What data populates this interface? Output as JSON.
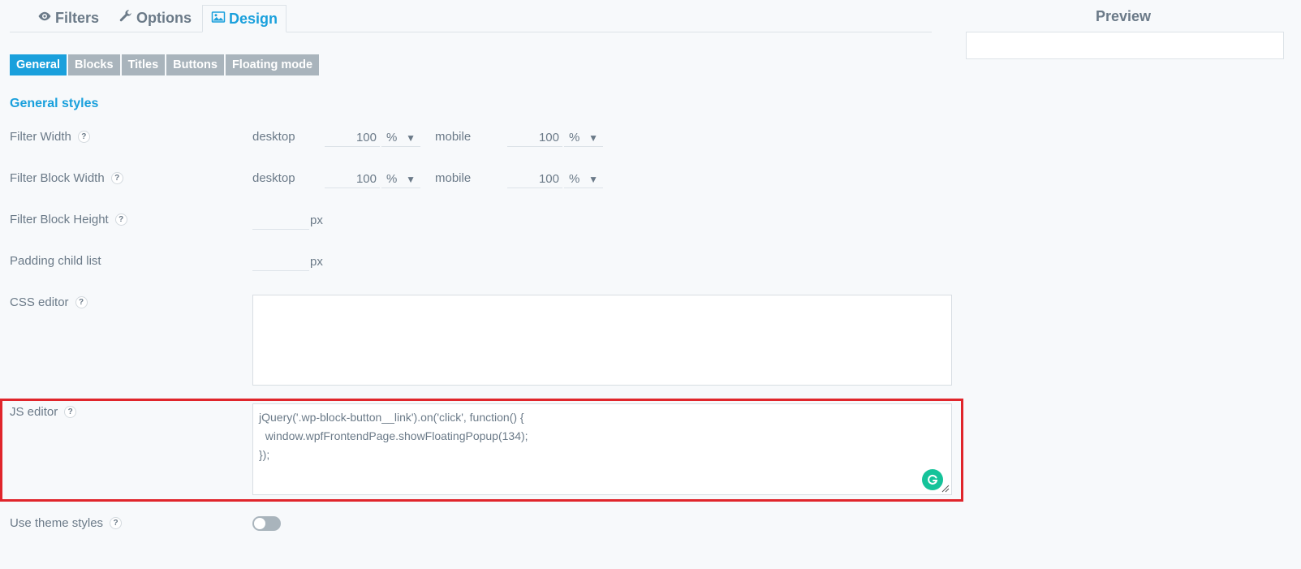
{
  "tabs": {
    "filters": "Filters",
    "options": "Options",
    "design": "Design"
  },
  "preview": {
    "title": "Preview"
  },
  "sub_tabs": [
    "General",
    "Blocks",
    "Titles",
    "Buttons",
    "Floating mode"
  ],
  "section_title": "General styles",
  "help_glyph": "?",
  "rows": {
    "filter_width": {
      "label": "Filter Width",
      "desktop_label": "desktop",
      "desktop_value": "100",
      "desktop_unit": "%",
      "mobile_label": "mobile",
      "mobile_value": "100",
      "mobile_unit": "%"
    },
    "filter_block_width": {
      "label": "Filter Block Width",
      "desktop_label": "desktop",
      "desktop_value": "100",
      "desktop_unit": "%",
      "mobile_label": "mobile",
      "mobile_value": "100",
      "mobile_unit": "%"
    },
    "filter_block_height": {
      "label": "Filter Block Height",
      "unit": "px",
      "value": ""
    },
    "padding_child_list": {
      "label": "Padding child list",
      "unit": "px",
      "value": ""
    },
    "css_editor": {
      "label": "CSS editor",
      "value": ""
    },
    "js_editor": {
      "label": "JS editor",
      "lines": [
        "jQuery('.wp-block-button__link').on('click', function() {",
        "  window.wpfFrontendPage.showFloatingPopup(134);",
        "});"
      ]
    },
    "use_theme_styles": {
      "label": "Use theme styles",
      "enabled": false
    }
  },
  "icons": {
    "filters": "eye-icon",
    "options": "wrench-icon",
    "design": "image-icon",
    "dropdown": "caret-down-icon",
    "grammarly": "grammarly-icon"
  },
  "colors": {
    "accent": "#1aa0dc",
    "subtab_inactive": "#a9b4bc",
    "highlight": "#e0252b",
    "grammarly": "#15c39a"
  }
}
